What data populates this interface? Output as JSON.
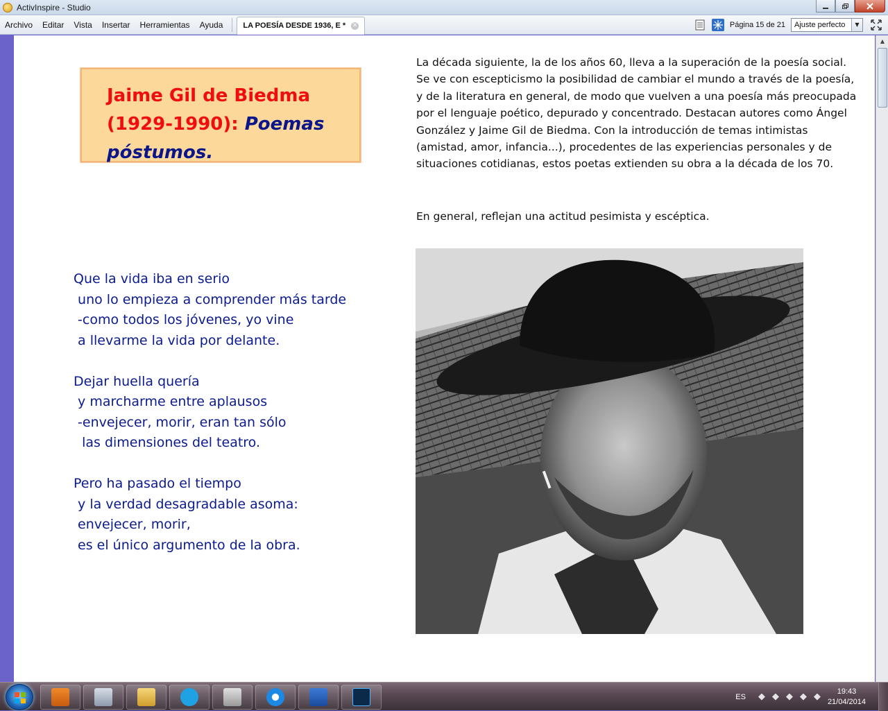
{
  "window": {
    "title": "ActivInspire - Studio"
  },
  "menu": {
    "items": [
      "Archivo",
      "Editar",
      "Vista",
      "Insertar",
      "Herramientas",
      "Ayuda"
    ],
    "doc_tab": "LA POESÍA DESDE 1936, E *",
    "page_indicator": "Página 15 de 21",
    "zoom": "Ajuste perfecto"
  },
  "slide": {
    "title_name": "Jaime Gil de Biedma",
    "title_dates": "(1929-1990):",
    "title_work": "Poemas póstumos.",
    "intro": "La década siguiente, la de los años 60, lleva a la superación de la poesía social. Se ve con escepticismo la posibilidad de cambiar el mundo a través de la poesía, y de la literatura en general, de modo que vuelven a una poesía más preocupada por el lenguaje poético, depurado y concentrado. Destacan autores como Ángel González y Jaime Gil de Biedma. Con la introducción de temas intimistas (amistad, amor, infancia...), procedentes de las experiencias personales y de situaciones cotidianas, estos poetas extienden su obra a la década de los 70.",
    "intro2": "En general, reflejan una actitud pesimista y escéptica.",
    "poem": "Que la vida iba en serio\n uno lo empieza a comprender más tarde\n -como todos los jóvenes, yo vine\n a llevarme la vida por delante.\n\nDejar huella quería\n y marcharme entre aplausos\n -envejecer, morir, eran tan sólo\n  las dimensiones del teatro.\n\nPero ha pasado el tiempo\n y la verdad desagradable asoma:\n envejecer, morir,\n es el único argumento de la obra."
  },
  "taskbar": {
    "apps": [
      "activinspire",
      "calculator",
      "explorer",
      "skype",
      "tool",
      "internet-explorer",
      "word",
      "photoshop"
    ],
    "lang": "ES",
    "time": "19:43",
    "date": "21/04/2014"
  }
}
